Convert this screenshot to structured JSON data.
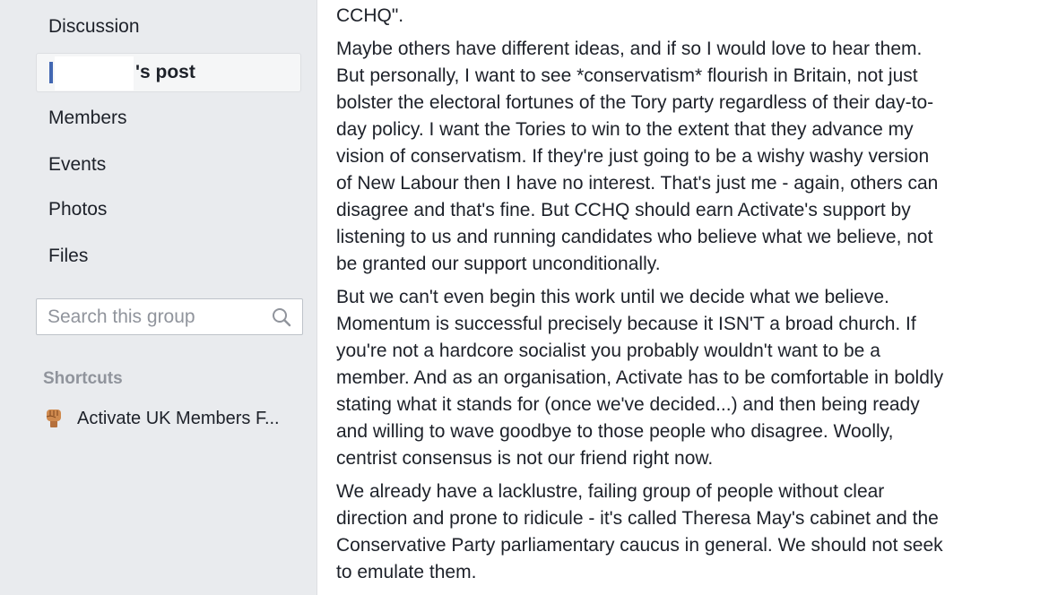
{
  "sidebar": {
    "nav_items": [
      {
        "label": "Discussion"
      },
      {
        "label": "Members"
      },
      {
        "label": "Events"
      },
      {
        "label": "Photos"
      },
      {
        "label": "Files"
      }
    ],
    "active_item": {
      "label": "'s post"
    },
    "search": {
      "placeholder": "Search this group"
    },
    "shortcuts": {
      "heading": "Shortcuts",
      "items": [
        {
          "label": "Activate UK Members F...",
          "icon": "raised-fist-icon"
        }
      ]
    }
  },
  "post": {
    "paragraphs": [
      {
        "lines": [
          "CCHQ\"."
        ]
      },
      {
        "lines": [
          "Maybe others have different ideas, and if so I would love to hear them.",
          "But personally, I want to see *conservatism* flourish in Britain, not just",
          "bolster the electoral fortunes of the Tory party regardless of their day-to-",
          "day policy. I want the Tories to win to the extent that they advance my",
          "vision of conservatism. If they're just going to be a wishy washy version",
          "of New Labour then I have no interest. That's just me - again, others can",
          "disagree and that's fine. But CCHQ should earn Activate's support by",
          "listening to us and running candidates who believe what we believe, not",
          "be granted our support unconditionally."
        ]
      },
      {
        "lines": [
          "But we can't even begin this work until we decide what we believe.",
          "Momentum is successful precisely because it ISN'T a broad church. If",
          "you're not a hardcore socialist you probably wouldn't want to be a",
          "member. And as an organisation, Activate has to be comfortable in boldly",
          "stating what it stands for (once we've decided...) and then being ready",
          "and willing to wave goodbye to those people who disagree. Woolly,",
          "centrist consensus is not our friend right now."
        ]
      },
      {
        "lines": [
          "We already have a lacklustre, failing group of people without clear",
          "direction and prone to ridicule - it's called Theresa May's cabinet and the",
          "Conservative Party parliamentary caucus in general. We should not seek",
          "to emulate them."
        ]
      }
    ]
  },
  "colors": {
    "accent": "#4267b2",
    "sidebar_bg": "#e9ebee",
    "text": "#1d2129",
    "muted": "#90949c"
  }
}
